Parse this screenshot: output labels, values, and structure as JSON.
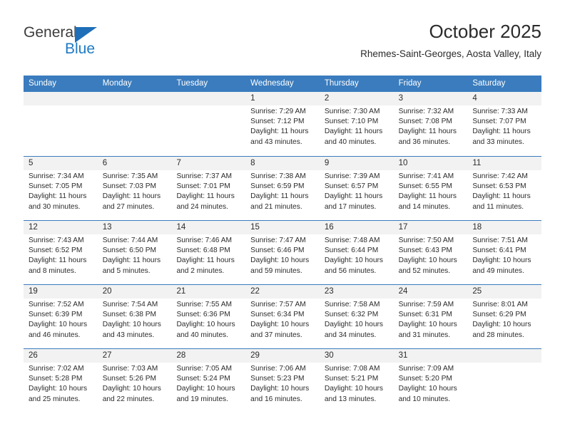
{
  "brand": {
    "name_top": "General",
    "name_bottom": "Blue",
    "triangle_color": "#1e6fb8",
    "blue_text_color": "#1e7ac4"
  },
  "header": {
    "title": "October 2025",
    "subtitle": "Rhemes-Saint-Georges, Aosta Valley, Italy"
  },
  "theme": {
    "header_blue": "#3a7cbe",
    "daynum_band": "#f2f2f2",
    "text": "#2b2b2b"
  },
  "weekdays": [
    "Sunday",
    "Monday",
    "Tuesday",
    "Wednesday",
    "Thursday",
    "Friday",
    "Saturday"
  ],
  "weeks": [
    [
      {
        "day": "",
        "empty": true
      },
      {
        "day": "",
        "empty": true
      },
      {
        "day": "",
        "empty": true
      },
      {
        "day": "1",
        "sunrise": "Sunrise: 7:29 AM",
        "sunset": "Sunset: 7:12 PM",
        "daylight1": "Daylight: 11 hours",
        "daylight2": "and 43 minutes."
      },
      {
        "day": "2",
        "sunrise": "Sunrise: 7:30 AM",
        "sunset": "Sunset: 7:10 PM",
        "daylight1": "Daylight: 11 hours",
        "daylight2": "and 40 minutes."
      },
      {
        "day": "3",
        "sunrise": "Sunrise: 7:32 AM",
        "sunset": "Sunset: 7:08 PM",
        "daylight1": "Daylight: 11 hours",
        "daylight2": "and 36 minutes."
      },
      {
        "day": "4",
        "sunrise": "Sunrise: 7:33 AM",
        "sunset": "Sunset: 7:07 PM",
        "daylight1": "Daylight: 11 hours",
        "daylight2": "and 33 minutes."
      }
    ],
    [
      {
        "day": "5",
        "sunrise": "Sunrise: 7:34 AM",
        "sunset": "Sunset: 7:05 PM",
        "daylight1": "Daylight: 11 hours",
        "daylight2": "and 30 minutes."
      },
      {
        "day": "6",
        "sunrise": "Sunrise: 7:35 AM",
        "sunset": "Sunset: 7:03 PM",
        "daylight1": "Daylight: 11 hours",
        "daylight2": "and 27 minutes."
      },
      {
        "day": "7",
        "sunrise": "Sunrise: 7:37 AM",
        "sunset": "Sunset: 7:01 PM",
        "daylight1": "Daylight: 11 hours",
        "daylight2": "and 24 minutes."
      },
      {
        "day": "8",
        "sunrise": "Sunrise: 7:38 AM",
        "sunset": "Sunset: 6:59 PM",
        "daylight1": "Daylight: 11 hours",
        "daylight2": "and 21 minutes."
      },
      {
        "day": "9",
        "sunrise": "Sunrise: 7:39 AM",
        "sunset": "Sunset: 6:57 PM",
        "daylight1": "Daylight: 11 hours",
        "daylight2": "and 17 minutes."
      },
      {
        "day": "10",
        "sunrise": "Sunrise: 7:41 AM",
        "sunset": "Sunset: 6:55 PM",
        "daylight1": "Daylight: 11 hours",
        "daylight2": "and 14 minutes."
      },
      {
        "day": "11",
        "sunrise": "Sunrise: 7:42 AM",
        "sunset": "Sunset: 6:53 PM",
        "daylight1": "Daylight: 11 hours",
        "daylight2": "and 11 minutes."
      }
    ],
    [
      {
        "day": "12",
        "sunrise": "Sunrise: 7:43 AM",
        "sunset": "Sunset: 6:52 PM",
        "daylight1": "Daylight: 11 hours",
        "daylight2": "and 8 minutes."
      },
      {
        "day": "13",
        "sunrise": "Sunrise: 7:44 AM",
        "sunset": "Sunset: 6:50 PM",
        "daylight1": "Daylight: 11 hours",
        "daylight2": "and 5 minutes."
      },
      {
        "day": "14",
        "sunrise": "Sunrise: 7:46 AM",
        "sunset": "Sunset: 6:48 PM",
        "daylight1": "Daylight: 11 hours",
        "daylight2": "and 2 minutes."
      },
      {
        "day": "15",
        "sunrise": "Sunrise: 7:47 AM",
        "sunset": "Sunset: 6:46 PM",
        "daylight1": "Daylight: 10 hours",
        "daylight2": "and 59 minutes."
      },
      {
        "day": "16",
        "sunrise": "Sunrise: 7:48 AM",
        "sunset": "Sunset: 6:44 PM",
        "daylight1": "Daylight: 10 hours",
        "daylight2": "and 56 minutes."
      },
      {
        "day": "17",
        "sunrise": "Sunrise: 7:50 AM",
        "sunset": "Sunset: 6:43 PM",
        "daylight1": "Daylight: 10 hours",
        "daylight2": "and 52 minutes."
      },
      {
        "day": "18",
        "sunrise": "Sunrise: 7:51 AM",
        "sunset": "Sunset: 6:41 PM",
        "daylight1": "Daylight: 10 hours",
        "daylight2": "and 49 minutes."
      }
    ],
    [
      {
        "day": "19",
        "sunrise": "Sunrise: 7:52 AM",
        "sunset": "Sunset: 6:39 PM",
        "daylight1": "Daylight: 10 hours",
        "daylight2": "and 46 minutes."
      },
      {
        "day": "20",
        "sunrise": "Sunrise: 7:54 AM",
        "sunset": "Sunset: 6:38 PM",
        "daylight1": "Daylight: 10 hours",
        "daylight2": "and 43 minutes."
      },
      {
        "day": "21",
        "sunrise": "Sunrise: 7:55 AM",
        "sunset": "Sunset: 6:36 PM",
        "daylight1": "Daylight: 10 hours",
        "daylight2": "and 40 minutes."
      },
      {
        "day": "22",
        "sunrise": "Sunrise: 7:57 AM",
        "sunset": "Sunset: 6:34 PM",
        "daylight1": "Daylight: 10 hours",
        "daylight2": "and 37 minutes."
      },
      {
        "day": "23",
        "sunrise": "Sunrise: 7:58 AM",
        "sunset": "Sunset: 6:32 PM",
        "daylight1": "Daylight: 10 hours",
        "daylight2": "and 34 minutes."
      },
      {
        "day": "24",
        "sunrise": "Sunrise: 7:59 AM",
        "sunset": "Sunset: 6:31 PM",
        "daylight1": "Daylight: 10 hours",
        "daylight2": "and 31 minutes."
      },
      {
        "day": "25",
        "sunrise": "Sunrise: 8:01 AM",
        "sunset": "Sunset: 6:29 PM",
        "daylight1": "Daylight: 10 hours",
        "daylight2": "and 28 minutes."
      }
    ],
    [
      {
        "day": "26",
        "sunrise": "Sunrise: 7:02 AM",
        "sunset": "Sunset: 5:28 PM",
        "daylight1": "Daylight: 10 hours",
        "daylight2": "and 25 minutes."
      },
      {
        "day": "27",
        "sunrise": "Sunrise: 7:03 AM",
        "sunset": "Sunset: 5:26 PM",
        "daylight1": "Daylight: 10 hours",
        "daylight2": "and 22 minutes."
      },
      {
        "day": "28",
        "sunrise": "Sunrise: 7:05 AM",
        "sunset": "Sunset: 5:24 PM",
        "daylight1": "Daylight: 10 hours",
        "daylight2": "and 19 minutes."
      },
      {
        "day": "29",
        "sunrise": "Sunrise: 7:06 AM",
        "sunset": "Sunset: 5:23 PM",
        "daylight1": "Daylight: 10 hours",
        "daylight2": "and 16 minutes."
      },
      {
        "day": "30",
        "sunrise": "Sunrise: 7:08 AM",
        "sunset": "Sunset: 5:21 PM",
        "daylight1": "Daylight: 10 hours",
        "daylight2": "and 13 minutes."
      },
      {
        "day": "31",
        "sunrise": "Sunrise: 7:09 AM",
        "sunset": "Sunset: 5:20 PM",
        "daylight1": "Daylight: 10 hours",
        "daylight2": "and 10 minutes."
      },
      {
        "day": "",
        "empty": true
      }
    ]
  ]
}
